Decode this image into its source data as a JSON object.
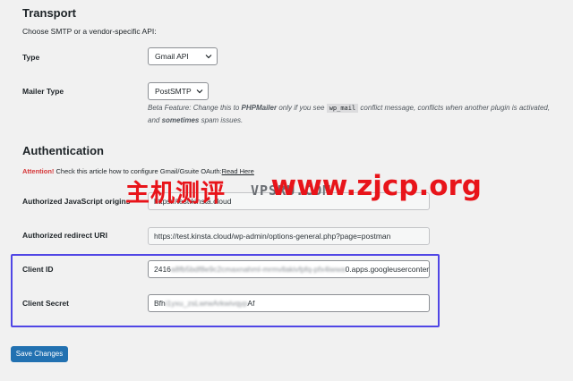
{
  "transport": {
    "heading": "Transport",
    "description": "Choose SMTP or a vendor-specific API:",
    "type_label": "Type",
    "type_value": "Gmail API",
    "mailer_label": "Mailer Type",
    "mailer_value": "PostSMTP",
    "beta_prefix": "Beta Feature: Change this to ",
    "beta_phpmailer": "PHPMailer",
    "beta_mid": " only if you see ",
    "beta_code": "wp_mail",
    "beta_mid2": " conflict message, conflicts when another plugin is activated, and ",
    "beta_sometimes": "sometimes",
    "beta_end": " spam issues."
  },
  "authentication": {
    "heading": "Authentication",
    "attention_label": "Attention!",
    "attention_text": " Check this article how to configure Gmail/Gsuite OAuth:",
    "read_here": "Read Here",
    "js_origins_label": "Authorized JavaScript origins",
    "js_origins_value": "https://test.kinsta.cloud",
    "redirect_label": "Authorized redirect URI",
    "redirect_value": "https://test.kinsta.cloud/wp-admin/options-general.php?page=postman",
    "client_id_label": "Client ID",
    "client_id_prefix": "2416",
    "client_id_blurred": "a8fb5bdf8e9c2cmaxnahml-mrmvllakivfpfq-pfx4iwwa",
    "client_id_suffix": "0.apps.googleusercontent.c",
    "client_secret_label": "Client Secret",
    "client_secret_prefix": "Bfh",
    "client_secret_blurred": "i1yxu_zsLwrwArkwivqyp",
    "client_secret_suffix": "Af"
  },
  "actions": {
    "save_label": "Save Changes"
  },
  "watermark": {
    "cn_text": "主机测评",
    "mid_text": "VPSRU.COM",
    "url_text": "www.zjcp.org"
  },
  "colors": {
    "accent": "#2271b1",
    "highlight_border": "#5046e5",
    "attention_red": "#d63638",
    "watermark_red": "#e8141a"
  }
}
